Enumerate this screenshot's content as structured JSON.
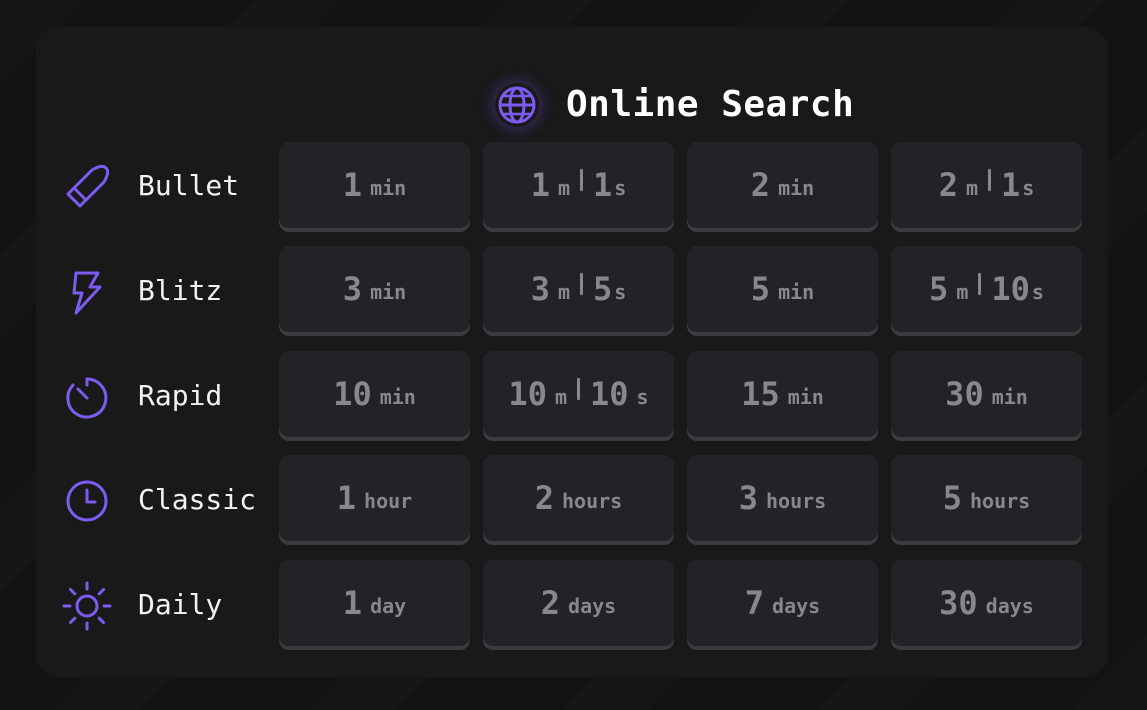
{
  "header": {
    "title": "Online Search",
    "icon": "globe-icon"
  },
  "accent_color": "#7c5cf0",
  "categories": [
    {
      "label": "Bullet",
      "icon": "bullet-icon",
      "options": [
        {
          "a": "1",
          "au": "min"
        },
        {
          "a": "1",
          "au": "m",
          "b": "1",
          "bu": "s"
        },
        {
          "a": "2",
          "au": "min"
        },
        {
          "a": "2",
          "au": "m",
          "b": "1",
          "bu": "s"
        }
      ]
    },
    {
      "label": "Blitz",
      "icon": "lightning-icon",
      "options": [
        {
          "a": "3",
          "au": "min"
        },
        {
          "a": "3",
          "au": "m",
          "b": "5",
          "bu": "s"
        },
        {
          "a": "5",
          "au": "min"
        },
        {
          "a": "5",
          "au": "m",
          "b": "10",
          "bu": "s"
        }
      ]
    },
    {
      "label": "Rapid",
      "icon": "timer-icon",
      "options": [
        {
          "a": "10",
          "au": "min"
        },
        {
          "a": "10",
          "au": "m",
          "b": "10",
          "bu": "s"
        },
        {
          "a": "15",
          "au": "min"
        },
        {
          "a": "30",
          "au": "min"
        }
      ]
    },
    {
      "label": "Classic",
      "icon": "clock-icon",
      "options": [
        {
          "a": "1",
          "au": "hour"
        },
        {
          "a": "2",
          "au": "hours"
        },
        {
          "a": "3",
          "au": "hours"
        },
        {
          "a": "5",
          "au": "hours"
        }
      ]
    },
    {
      "label": "Daily",
      "icon": "sun-icon",
      "options": [
        {
          "a": "1",
          "au": "day"
        },
        {
          "a": "2",
          "au": "days"
        },
        {
          "a": "7",
          "au": "days"
        },
        {
          "a": "30",
          "au": "days"
        }
      ]
    }
  ]
}
